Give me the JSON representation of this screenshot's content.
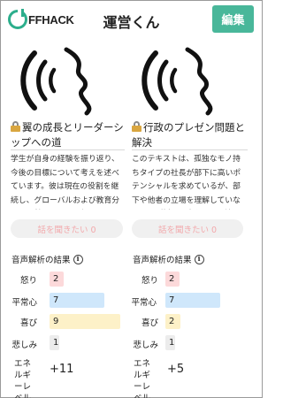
{
  "header": {
    "logo_text": "FFHACK",
    "title": "運営くん",
    "edit_label": "編集"
  },
  "cards": [
    {
      "title": "翼の成長とリーダーシップへの道",
      "description": "学生が自身の経験を振り返り、今後の目標について考えを述べています。彼は現在の役割を継続し、グローバルおよび教育分野に貢献することを望んでいます。具体...",
      "talk_button": "話を聞きたい 0",
      "analysis_title": "音声解析の結果",
      "emotions": [
        {
          "label": "怒り",
          "value": "2",
          "level": 2
        },
        {
          "label": "平常心",
          "value": "7",
          "level": 7
        },
        {
          "label": "喜び",
          "value": "9",
          "level": 9
        },
        {
          "label": "悲しみ",
          "value": "1",
          "level": 1
        }
      ],
      "energy_label": "エネルギーレベル",
      "energy_value": "+11"
    },
    {
      "title": "行政のプレゼン問題と解決",
      "description": "このテキストは、孤独なモノ持ちタイプの社長が部下に高いポテンシャルを求めているが、部下や他者の立場を理解していないことが話題の中心です。社長は自身の...",
      "talk_button": "話を聞きたい 0",
      "analysis_title": "音声解析の結果",
      "emotions": [
        {
          "label": "怒り",
          "value": "2",
          "level": 2
        },
        {
          "label": "平常心",
          "value": "7",
          "level": 7
        },
        {
          "label": "喜び",
          "value": "2",
          "level": 2
        },
        {
          "label": "悲しみ",
          "value": "1",
          "level": 1
        }
      ],
      "energy_label": "エネルギーレベル",
      "energy_value": "+5"
    }
  ],
  "colors": {
    "accent": "#49b79a",
    "anger": "#fcd9da",
    "calm": "#cfe7fb",
    "joy": "#fdf1c8",
    "sadness": "#ececec",
    "talk_text": "#f2a9ac"
  }
}
